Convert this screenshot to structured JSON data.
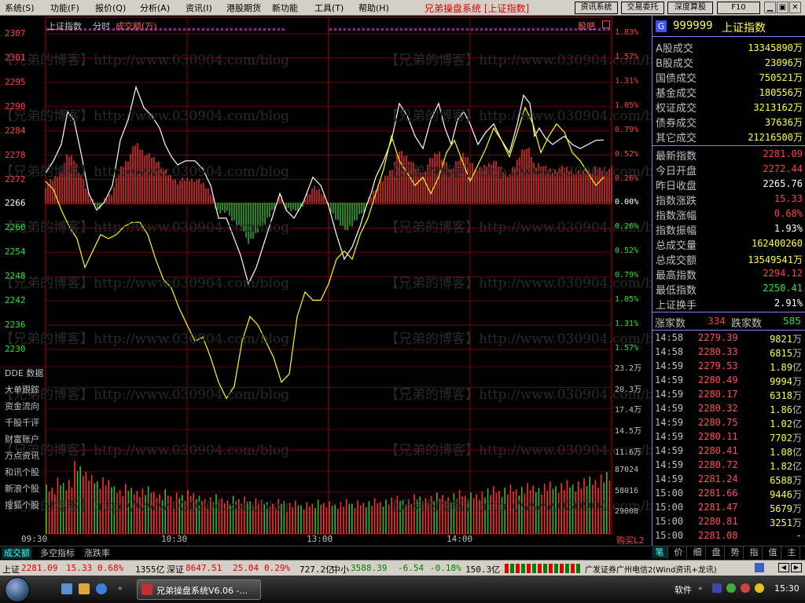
{
  "menu": {
    "items": [
      "系统(S)",
      "功能(F)",
      "报价(Q)",
      "分析(A)",
      "资讯(I)",
      "港股期货",
      "新功能",
      "工具(T)",
      "帮助(H)"
    ],
    "app_title": "兄弟操盘系统 [上证指数]",
    "buttons": [
      "资讯系统",
      "交易委托",
      "深度算股",
      "F10"
    ],
    "win": [
      "▁",
      "▣",
      "✕"
    ]
  },
  "chart_header": {
    "index_name": "上证指数",
    "period": "分时",
    "metric": "成交额(万)",
    "guba": "股吧"
  },
  "price_axis": {
    "left": [
      "2307",
      "2301",
      "2295",
      "2290",
      "2284",
      "2278",
      "2272",
      "2266",
      "2260",
      "2254",
      "2248",
      "2242",
      "2236",
      "2230"
    ],
    "right": [
      "1.83%",
      "1.57%",
      "1.31%",
      "1.05%",
      "0.79%",
      "0.52%",
      "0.26%",
      "0.00%",
      "0.26%",
      "0.52%",
      "0.79%",
      "1.05%",
      "1.31%",
      "1.57%"
    ]
  },
  "vol_axis": [
    "23.2万",
    "20.3万",
    "17.4万",
    "14.5万",
    "11.6万",
    "87024",
    "58016",
    "29008"
  ],
  "side_menu": [
    "DDE 数据",
    "大单跟踪",
    "资金流向",
    "千股千评",
    "财富账户",
    "万点资讯",
    "和讯个股",
    "新浪个股",
    "搜狐个股"
  ],
  "time_labels": [
    "09:30",
    "10:30",
    "13:00",
    "14:00"
  ],
  "buy_sell": "购买L2",
  "bottom_tabs": [
    "成交额",
    "多空指标",
    "涨跌率"
  ],
  "watermark": "【兄弟的博客】http://www.030904.com/blog",
  "rpanel": {
    "badge": "G",
    "code": "999999",
    "name": "上证指数",
    "volume_rows": [
      {
        "k": "A股成交",
        "v": "13345890万"
      },
      {
        "k": "B股成交",
        "v": "23096万"
      },
      {
        "k": "国债成交",
        "v": "750521万"
      },
      {
        "k": "基金成交",
        "v": "180556万"
      },
      {
        "k": "权证成交",
        "v": "3213162万"
      },
      {
        "k": "债券成交",
        "v": "37636万"
      },
      {
        "k": "其它成交",
        "v": "21216500万"
      }
    ],
    "quote_rows": [
      {
        "k": "最新指数",
        "v": "2281.09",
        "c": "#ff4040"
      },
      {
        "k": "今日开盘",
        "v": "2272.44",
        "c": "#ff4040"
      },
      {
        "k": "昨日收盘",
        "v": "2265.76",
        "c": "#ffffff"
      },
      {
        "k": "指数涨跌",
        "v": "15.33",
        "c": "#ff4040"
      },
      {
        "k": "指数涨幅",
        "v": "0.68%",
        "c": "#ff4040"
      },
      {
        "k": "指数振幅",
        "v": "1.93%",
        "c": "#ffffff"
      },
      {
        "k": "总成交量",
        "v": "162400260",
        "c": "#ffff40"
      },
      {
        "k": "总成交额",
        "v": "13549541万",
        "c": "#ffff40"
      },
      {
        "k": "最高指数",
        "v": "2294.12",
        "c": "#ff4040"
      },
      {
        "k": "最低指数",
        "v": "2250.41",
        "c": "#30e030"
      },
      {
        "k": "上证换手",
        "v": "2.91%",
        "c": "#ffffff"
      }
    ],
    "up_label": "涨家数",
    "up_count": "334",
    "down_label": "跌家数",
    "down_count": "585",
    "ticks": [
      {
        "t": "14:58",
        "p": "2279.39",
        "v": "9821",
        "u": "万"
      },
      {
        "t": "14:58",
        "p": "2280.33",
        "v": "6815",
        "u": "万"
      },
      {
        "t": "14:59",
        "p": "2279.53",
        "v": "1.89",
        "u": "亿"
      },
      {
        "t": "14:59",
        "p": "2280.49",
        "v": "9994",
        "u": "万"
      },
      {
        "t": "14:59",
        "p": "2280.17",
        "v": "6318",
        "u": "万"
      },
      {
        "t": "14:59",
        "p": "2280.32",
        "v": "1.86",
        "u": "亿"
      },
      {
        "t": "14:59",
        "p": "2280.75",
        "v": "1.02",
        "u": "亿"
      },
      {
        "t": "14:59",
        "p": "2280.11",
        "v": "7702",
        "u": "万"
      },
      {
        "t": "14:59",
        "p": "2280.41",
        "v": "1.08",
        "u": "亿"
      },
      {
        "t": "14:59",
        "p": "2280.72",
        "v": "1.82",
        "u": "亿"
      },
      {
        "t": "14:59",
        "p": "2281.24",
        "v": "6588",
        "u": "万"
      },
      {
        "t": "15:00",
        "p": "2281.66",
        "v": "9446",
        "u": "万"
      },
      {
        "t": "15:00",
        "p": "2281.47",
        "v": "5679",
        "u": "万"
      },
      {
        "t": "15:00",
        "p": "2280.81",
        "v": "3251",
        "u": "万"
      },
      {
        "t": "15:00",
        "p": "2281.08",
        "v": "-",
        "u": ""
      }
    ],
    "tabs": [
      "笔",
      "价",
      "细",
      "盘",
      "势",
      "指",
      "值",
      "主"
    ]
  },
  "status": {
    "sh_label": "上证",
    "sh_price": "2281.09",
    "sh_change": "15.33",
    "sh_pct": "0.68%",
    "sh_amount": "1355亿",
    "sz_label": "深证",
    "sz_price": "8647.51",
    "sz_change": "25.04",
    "sz_pct": "0.29%",
    "sz_amount": "727.2亿",
    "sme_label": "中小",
    "sme_price": "3588.39",
    "sme_change": "-6.54",
    "sme_pct": "-0.18%",
    "sme_amount": "150.3亿",
    "broker": "广发证券广州电信2(Wind资讯+龙讯)"
  },
  "taskbar": {
    "window": "兄弟操盘系统V6.06 -...",
    "soft": "软件",
    "clock": "15:30"
  },
  "chart_data": [
    {
      "type": "line",
      "title": "上证指数",
      "ylim": [
        2230,
        2307
      ],
      "prev_close": 2265.76,
      "series": [
        {
          "name": "上证指数",
          "color": "#ffffff",
          "points": [
            [
              0,
              2273
            ],
            [
              10,
              2276
            ],
            [
              20,
              2280
            ],
            [
              28,
              2288
            ],
            [
              36,
              2286
            ],
            [
              45,
              2278
            ],
            [
              55,
              2268
            ],
            [
              65,
              2264
            ],
            [
              75,
              2266
            ],
            [
              85,
              2270
            ],
            [
              95,
              2281
            ],
            [
              105,
              2286
            ],
            [
              115,
              2294
            ],
            [
              125,
              2289
            ],
            [
              135,
              2287
            ],
            [
              145,
              2284
            ],
            [
              152,
              2280
            ],
            [
              160,
              2277
            ],
            [
              168,
              2275
            ],
            [
              178,
              2276
            ],
            [
              190,
              2276
            ],
            [
              200,
              2274
            ],
            [
              210,
              2270
            ],
            [
              220,
              2262
            ],
            [
              230,
              2262
            ],
            [
              238,
              2258
            ],
            [
              248,
              2253
            ],
            [
              258,
              2246
            ],
            [
              268,
              2250
            ],
            [
              278,
              2256
            ],
            [
              288,
              2262
            ],
            [
              298,
              2268
            ],
            [
              306,
              2264
            ],
            [
              316,
              2262
            ],
            [
              328,
              2266
            ],
            [
              340,
              2272
            ],
            [
              350,
              2270
            ],
            [
              360,
              2265
            ],
            [
              370,
              2258
            ],
            [
              380,
              2252
            ],
            [
              390,
              2255
            ],
            [
              400,
              2260
            ],
            [
              408,
              2265
            ],
            [
              414,
              2268
            ],
            [
              420,
              2272
            ],
            [
              430,
              2276
            ],
            [
              440,
              2281
            ],
            [
              450,
              2290
            ],
            [
              460,
              2287
            ],
            [
              470,
              2282
            ],
            [
              480,
              2279
            ],
            [
              490,
              2286
            ],
            [
              500,
              2290
            ],
            [
              508,
              2284
            ],
            [
              516,
              2280
            ],
            [
              524,
              2286
            ],
            [
              532,
              2288
            ],
            [
              540,
              2285
            ],
            [
              550,
              2280
            ],
            [
              560,
              2283
            ],
            [
              570,
              2285
            ],
            [
              580,
              2281
            ],
            [
              590,
              2278
            ],
            [
              600,
              2285
            ],
            [
              608,
              2292
            ],
            [
              616,
              2290
            ],
            [
              622,
              2282
            ],
            [
              628,
              2284
            ],
            [
              636,
              2281.5
            ],
            [
              645,
              2280
            ],
            [
              652,
              2281
            ],
            [
              660,
              2282
            ],
            [
              670,
              2280
            ],
            [
              680,
              2279
            ],
            [
              690,
              2280
            ],
            [
              700,
              2281
            ],
            [
              710,
              2281.09
            ]
          ]
        },
        {
          "name": "均价",
          "color": "#ffff00",
          "points": [
            [
              0,
              2271
            ],
            [
              10,
              2269
            ],
            [
              20,
              2264
            ],
            [
              30,
              2260
            ],
            [
              40,
              2257
            ],
            [
              50,
              2250
            ],
            [
              60,
              2254
            ],
            [
              70,
              2258
            ],
            [
              80,
              2257
            ],
            [
              90,
              2258
            ],
            [
              100,
              2260
            ],
            [
              110,
              2261
            ],
            [
              120,
              2261
            ],
            [
              130,
              2258
            ],
            [
              140,
              2252
            ],
            [
              150,
              2247
            ],
            [
              160,
              2245
            ],
            [
              170,
              2240
            ],
            [
              180,
              2236
            ],
            [
              190,
              2232
            ],
            [
              200,
              2233
            ],
            [
              210,
              2228
            ],
            [
              220,
              2222
            ],
            [
              230,
              2218
            ],
            [
              240,
              2221
            ],
            [
              250,
              2232
            ],
            [
              260,
              2238
            ],
            [
              270,
              2236
            ],
            [
              280,
              2232
            ],
            [
              290,
              2228
            ],
            [
              300,
              2222
            ],
            [
              310,
              2224
            ],
            [
              320,
              2238
            ],
            [
              330,
              2244
            ],
            [
              340,
              2242
            ],
            [
              350,
              2242
            ],
            [
              360,
              2246
            ],
            [
              370,
              2252
            ],
            [
              380,
              2254
            ],
            [
              390,
              2252
            ],
            [
              400,
              2258
            ],
            [
              410,
              2262
            ],
            [
              420,
              2268
            ],
            [
              430,
              2274
            ],
            [
              440,
              2282
            ],
            [
              450,
              2276
            ],
            [
              460,
              2273
            ],
            [
              470,
              2270
            ],
            [
              480,
              2272
            ],
            [
              490,
              2268
            ],
            [
              500,
              2272
            ],
            [
              510,
              2278
            ],
            [
              520,
              2281
            ],
            [
              530,
              2276
            ],
            [
              540,
              2271
            ],
            [
              550,
              2275
            ],
            [
              560,
              2279
            ],
            [
              570,
              2284
            ],
            [
              580,
              2281
            ],
            [
              590,
              2277
            ],
            [
              600,
              2283
            ],
            [
              610,
              2289
            ],
            [
              620,
              2285
            ],
            [
              630,
              2278
            ],
            [
              640,
              2282
            ],
            [
              650,
              2285
            ],
            [
              660,
              2283
            ],
            [
              670,
              2278
            ],
            [
              680,
              2276
            ],
            [
              690,
              2273
            ],
            [
              700,
              2270
            ],
            [
              710,
              2272
            ]
          ]
        }
      ]
    },
    {
      "type": "bar",
      "title": "成交额(万)",
      "ylim": [
        0,
        232000
      ],
      "values": [
        62000,
        58000,
        71000,
        64000,
        68000,
        92000,
        85000,
        78000,
        74000,
        66000,
        71000,
        68000,
        60000,
        55000,
        63000,
        58000,
        54000,
        57000,
        60000,
        53000,
        50000,
        56000,
        47000,
        52000,
        49000,
        55000,
        51000,
        48000,
        44000,
        46000,
        50000,
        45000,
        42000,
        48000,
        44000,
        47000,
        41000,
        45000,
        43000,
        40000,
        38000,
        44000,
        41000,
        39000,
        42000,
        36000,
        40000,
        38000,
        43000,
        39000,
        41000,
        37000,
        40000,
        44000,
        38000,
        42000,
        39000,
        41000,
        45000,
        40000,
        43000,
        46000,
        48000,
        42000,
        44000,
        50000,
        47000,
        45000,
        48000,
        52000,
        49000,
        46000,
        51000,
        55000,
        48000,
        52000,
        50000,
        53000,
        57000,
        60000,
        54000,
        58000,
        62000,
        56000,
        59000,
        64000,
        61000,
        58000,
        63000,
        66000,
        60000,
        64000,
        68000,
        62000,
        66000,
        70000,
        72000,
        68000,
        75000,
        78000
      ]
    }
  ]
}
